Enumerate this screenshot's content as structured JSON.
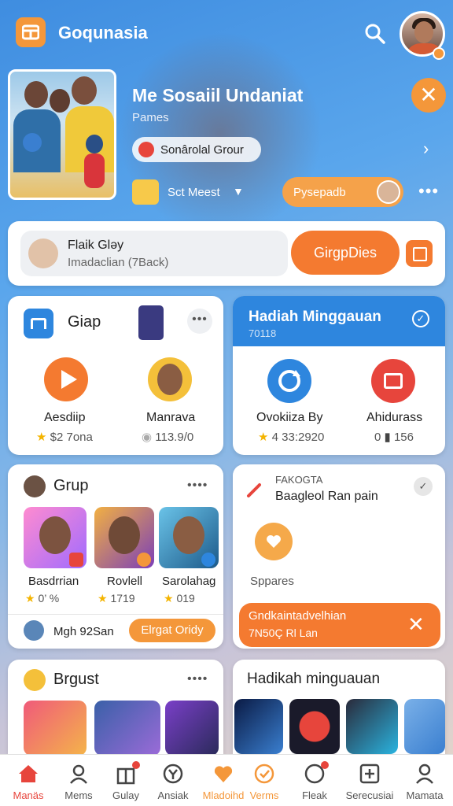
{
  "app": {
    "name": "Goqunasia"
  },
  "hero": {
    "title": "Me Sosaiil Undaniat",
    "subtitle": "Pames",
    "group_pill": "Sonârolal Grour",
    "meet_label": "Sct Meest",
    "orange_pill": "Pysepadb"
  },
  "compose": {
    "name": "Flaik Gləy",
    "placeholder": "Imadaclian (7Back)",
    "button": "GirgpDies"
  },
  "card_giap": {
    "title": "Giap",
    "items": [
      {
        "label": "Aesdiip",
        "stat": "$2 7ona"
      },
      {
        "label": "Manrava",
        "stat": "113.9/0"
      }
    ]
  },
  "card_hadiah": {
    "title": "Hadiah Minggauan",
    "subtitle": "70118",
    "items": [
      {
        "label": "Ovokiiza By",
        "stat": "4 33:2920"
      },
      {
        "label": "Ahidurass",
        "stat_prefix": "0",
        "stat": "156"
      }
    ]
  },
  "card_grup": {
    "title": "Grup",
    "members": [
      {
        "name": "Basdrrian",
        "stat": "0’ %"
      },
      {
        "name": "Rovlell",
        "stat": "1719"
      },
      {
        "name": "Sarolahag",
        "stat": "019"
      }
    ],
    "footer_text": "Mgh 92San",
    "footer_button": "Elrgat Oridy"
  },
  "card_fakogta": {
    "kicker": "FAKOGTA",
    "title": "Baagleol Ran pain",
    "action_label": "Sppares",
    "banner_line1": "Gndkaintadvelhian",
    "banner_line2": "7N50Ç Rl Lan"
  },
  "card_brgust": {
    "title": "Brgust"
  },
  "card_hadikah": {
    "title": "Hadikah minguauan"
  },
  "nav": [
    {
      "label": "Manäs",
      "icon": "home-icon",
      "active": true
    },
    {
      "label": "Mems",
      "icon": "people-icon"
    },
    {
      "label": "Gulay",
      "icon": "gift-icon"
    },
    {
      "label": "Ansiak",
      "icon": "currency-icon"
    },
    {
      "label": "Mladoihd",
      "icon": "heart-icon",
      "accent": true
    },
    {
      "label": "Verms",
      "icon": "reward-icon",
      "accent": true
    },
    {
      "label": "Fleak",
      "icon": "chat-icon"
    },
    {
      "label": "Serecusiai",
      "icon": "add-square-icon"
    },
    {
      "label": "Mamata",
      "icon": "profile-icon"
    }
  ],
  "colors": {
    "accent": "#f47a30",
    "brand_blue": "#2e86de",
    "active_nav": "#e7453c"
  }
}
